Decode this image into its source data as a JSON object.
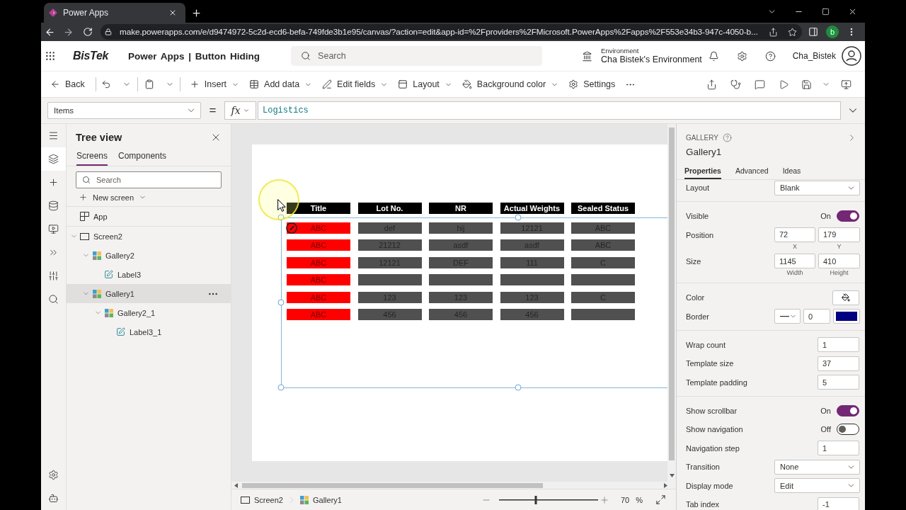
{
  "browser": {
    "tab_title": "Power Apps",
    "url": "make.powerapps.com/e/d9474972-5c2d-ecd6-befa-749fde3b1e95/canvas/?action=edit&app-id=%2Fproviders%2FMicrosoft.PowerApps%2Fapps%2F553e34b3-947c-4050-b...",
    "profile_initial": "b"
  },
  "app_header": {
    "logo_text": "BisTek",
    "app_title": "Power Apps | Button Hiding",
    "search_placeholder": "Search",
    "environment_label": "Environment",
    "environment_name": "Cha Bistek's Environment",
    "user_name": "Cha_Bistek"
  },
  "command_bar": {
    "back_label": "Back",
    "commands": [
      {
        "label": "Insert",
        "has_menu": true
      },
      {
        "label": "Add data",
        "has_menu": true
      },
      {
        "label": "Edit fields",
        "has_menu": true
      },
      {
        "label": "Layout",
        "has_menu": true
      },
      {
        "label": "Background color",
        "has_menu": true
      },
      {
        "label": "Settings",
        "has_menu": false
      }
    ]
  },
  "formula_bar": {
    "property": "Items",
    "equals": "=",
    "function_label": "fx",
    "formula": "Logistics"
  },
  "left_rail": [
    {
      "selected": false
    },
    {
      "selected": true
    },
    {
      "selected": false
    },
    {
      "selected": false
    },
    {
      "selected": false
    },
    {
      "selected": false
    },
    {
      "selected": false
    },
    {
      "selected": false
    },
    {
      "selected": false
    },
    {
      "selected": false
    }
  ],
  "tree_view": {
    "title": "Tree view",
    "tabs": [
      {
        "label": "Screens",
        "selected": true
      },
      {
        "label": "Components",
        "selected": false
      }
    ],
    "search_placeholder": "Search",
    "new_screen_label": "New screen",
    "app_item": {
      "name": "App",
      "selected": false
    },
    "items": [
      {
        "name": "Screen2",
        "kind": "screen",
        "expanded": true,
        "selected": false,
        "children": [
          {
            "name": "Gallery2",
            "kind": "gallery",
            "expanded": true,
            "selected": false,
            "children": [
              {
                "name": "Label3",
                "kind": "label",
                "selected": false
              }
            ]
          },
          {
            "name": "Gallery1",
            "kind": "gallery",
            "expanded": true,
            "selected": true,
            "children": [
              {
                "name": "Gallery2_1",
                "kind": "gallery",
                "expanded": true,
                "selected": false,
                "children": [
                  {
                    "name": "Label3_1",
                    "kind": "label",
                    "selected": false
                  }
                ]
              }
            ]
          }
        ]
      }
    ]
  },
  "canvas": {
    "columns": [
      {
        "heading": "Title",
        "color": "#ff0000"
      },
      {
        "heading": "Lot No.",
        "color": "#505050"
      },
      {
        "heading": "NR",
        "color": "#505050"
      },
      {
        "heading": "Actual Weights",
        "color": "#505050"
      },
      {
        "heading": "Sealed Status",
        "color": "#505050"
      }
    ],
    "rows": [
      {
        "selected": true,
        "title": "ABC",
        "lot_no": "def",
        "nr": "hij",
        "actual_weights": "12121",
        "sealed_status": "ABC"
      },
      {
        "selected": false,
        "title": "ABC",
        "lot_no": "21212",
        "nr": "asdf",
        "actual_weights": "asdf",
        "sealed_status": "ABC"
      },
      {
        "selected": false,
        "title": "ABC",
        "lot_no": "12121",
        "nr": "DEF",
        "actual_weights": "111",
        "sealed_status": "C"
      },
      {
        "selected": false,
        "title": "ABC"
      },
      {
        "selected": false,
        "title": "ABC",
        "lot_no": "123",
        "nr": "123",
        "actual_weights": "123",
        "sealed_status": "C"
      },
      {
        "selected": false,
        "title": "ABC",
        "lot_no": "456",
        "nr": "456",
        "actual_weights": "456"
      }
    ]
  },
  "properties_panel": {
    "control_type": "GALLERY",
    "control_name": "Gallery1",
    "tabs": [
      {
        "label": "Properties",
        "selected": true
      },
      {
        "label": "Advanced",
        "selected": false
      },
      {
        "label": "Ideas",
        "selected": false
      }
    ],
    "sections": [
      {
        "rows": [
          {
            "kind": "dropdown",
            "label": "Layout",
            "value": "Blank"
          }
        ]
      },
      {
        "rows": [
          {
            "kind": "toggle",
            "label": "Visible",
            "on": true,
            "state_label": "On"
          },
          {
            "kind": "pair",
            "label": "Position",
            "fields": [
              {
                "value": "72",
                "caption": "X"
              },
              {
                "value": "179",
                "caption": "Y"
              }
            ]
          },
          {
            "kind": "pair",
            "label": "Size",
            "fields": [
              {
                "value": "1145",
                "caption": "Width"
              },
              {
                "value": "410",
                "caption": "Height"
              }
            ]
          }
        ]
      },
      {
        "rows": [
          {
            "kind": "color",
            "label": "Color"
          },
          {
            "kind": "border",
            "label": "Border",
            "thickness": "0",
            "color": "#000080"
          }
        ]
      },
      {
        "rows": [
          {
            "kind": "number",
            "label": "Wrap count",
            "value": "1"
          },
          {
            "kind": "number",
            "label": "Template size",
            "value": "37"
          },
          {
            "kind": "number",
            "label": "Template padding",
            "value": "5"
          }
        ]
      },
      {
        "rows": [
          {
            "kind": "toggle",
            "label": "Show scrollbar",
            "on": true,
            "state_label": "On"
          },
          {
            "kind": "toggle",
            "label": "Show navigation",
            "on": false,
            "state_label": "Off"
          },
          {
            "kind": "number",
            "label": "Navigation step",
            "value": "1"
          },
          {
            "kind": "dropdown",
            "label": "Transition",
            "value": "None"
          },
          {
            "kind": "dropdown",
            "label": "Display mode",
            "value": "Edit"
          },
          {
            "kind": "number",
            "label": "Tab index",
            "value": "-1"
          }
        ]
      }
    ]
  },
  "status_bar": {
    "breadcrumbs": [
      {
        "label": "Screen2",
        "kind": "screen"
      },
      {
        "label": "Gallery1",
        "kind": "gallery"
      }
    ],
    "zoom": {
      "level": 0.37,
      "value": "70",
      "unit": "%"
    }
  }
}
